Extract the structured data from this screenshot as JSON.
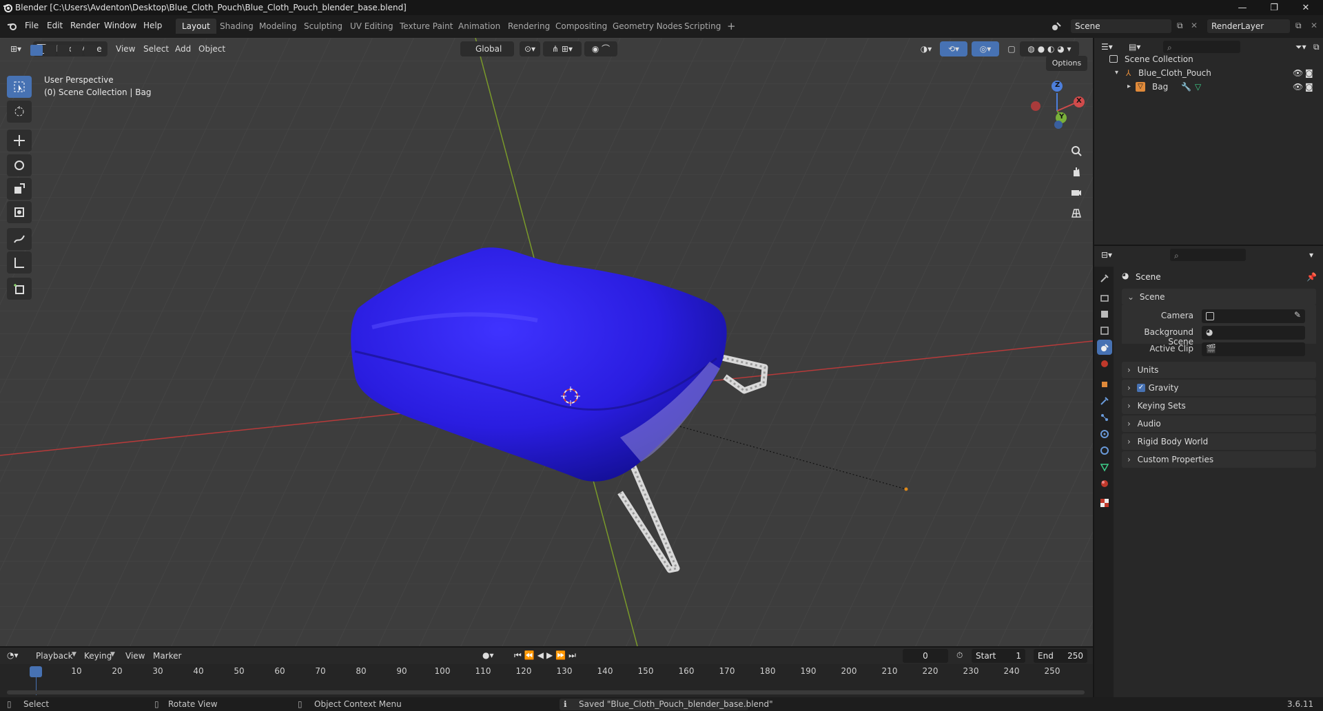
{
  "window": {
    "title": "Blender [C:\\Users\\Avdenton\\Desktop\\Blue_Cloth_Pouch\\Blue_Cloth_Pouch_blender_base.blend]",
    "controls": [
      "—",
      "❐",
      "✕"
    ]
  },
  "menu": {
    "items": [
      "File",
      "Edit",
      "Render",
      "Window",
      "Help"
    ]
  },
  "workspaces": {
    "tabs": [
      "Layout",
      "Shading",
      "Modeling",
      "Sculpting",
      "UV Editing",
      "Texture Paint",
      "Animation",
      "Rendering",
      "Compositing",
      "Geometry Nodes",
      "Scripting"
    ],
    "active": "Layout",
    "add_label": "+"
  },
  "scene_selector": {
    "value": "Scene"
  },
  "viewlayer_selector": {
    "value": "RenderLayer"
  },
  "viewport": {
    "mode": "Object Mode",
    "menus": [
      "View",
      "Select",
      "Add",
      "Object"
    ],
    "orientation": "Global",
    "options_label": "Options",
    "overlay_title": "User Perspective",
    "overlay_subtitle": "(0) Scene Collection | Bag",
    "gizmo": {
      "z": "Z",
      "y": "Y",
      "x": "X"
    }
  },
  "outliner": {
    "rows": [
      {
        "label": "Scene Collection"
      },
      {
        "label": "Blue_Cloth_Pouch"
      },
      {
        "label": "Bag"
      }
    ]
  },
  "properties": {
    "context_title": "Scene",
    "section": "Scene",
    "fields": [
      {
        "label": "Camera"
      },
      {
        "label": "Background Scene"
      },
      {
        "label": "Active Clip"
      }
    ],
    "panels": [
      "Units",
      "Gravity",
      "Keying Sets",
      "Audio",
      "Rigid Body World",
      "Custom Properties"
    ],
    "gravity_checked": true
  },
  "timeline": {
    "menus": [
      "Playback",
      "Keying",
      "View",
      "Marker"
    ],
    "current_frame": "0",
    "start_label": "Start",
    "start_value": "1",
    "end_label": "End",
    "end_value": "250",
    "ticks": [
      "0",
      "10",
      "20",
      "30",
      "40",
      "50",
      "60",
      "70",
      "80",
      "90",
      "100",
      "110",
      "120",
      "130",
      "140",
      "150",
      "160",
      "170",
      "180",
      "190",
      "200",
      "210",
      "220",
      "230",
      "240",
      "250"
    ]
  },
  "statusbar": {
    "select": "Select",
    "rotate": "Rotate View",
    "context_menu": "Object Context Menu",
    "message": "Saved \"Blue_Cloth_Pouch_blender_base.blend\"",
    "version": "3.6.11"
  },
  "colors": {
    "accent": "#4772b3",
    "pouch": "#2a1de0",
    "axis_x": "#b83a3a",
    "axis_y": "#7a9a2a"
  }
}
